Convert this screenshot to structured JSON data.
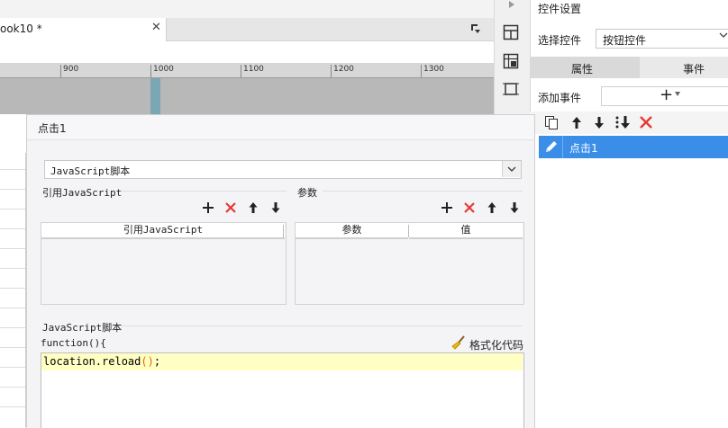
{
  "tab": {
    "label": "ook10 *",
    "close": "✕"
  },
  "ruler": {
    "labels": [
      "900",
      "1000",
      "1100",
      "1200",
      "1300"
    ]
  },
  "right_panel": {
    "title": "控件设置",
    "select_label": "选择控件",
    "select_value": "按钮控件",
    "tabs": {
      "attributes": "属性",
      "events": "事件",
      "active": "events"
    },
    "add_event_label": "添加事件",
    "add_symbol": "+",
    "events": [
      {
        "label": "点击1",
        "selected": true
      }
    ]
  },
  "dialog": {
    "title": "点击1",
    "type_select": "JavaScript脚本",
    "refs": {
      "label": "引用JavaScript",
      "columns": [
        "引用JavaScript"
      ]
    },
    "params": {
      "label": "参数",
      "columns": [
        "参数",
        "值"
      ]
    },
    "script": {
      "label": "JavaScript脚本",
      "header": "function(){",
      "format_label": "格式化代码",
      "code_before": "location.reload",
      "code_parens": "()",
      "code_after": ";"
    }
  },
  "colors": {
    "accent": "#3b8ee8",
    "delete": "#e53935",
    "highlight": "#ffffc4"
  },
  "icons": [
    "dropdown-corner-icon",
    "layout-icon",
    "grid-icon",
    "frame-icon",
    "copy-icon",
    "arrow-up-icon",
    "arrow-down-icon",
    "move-to-bottom-icon",
    "delete-icon",
    "pencil-icon",
    "add-icon",
    "broom-icon"
  ]
}
